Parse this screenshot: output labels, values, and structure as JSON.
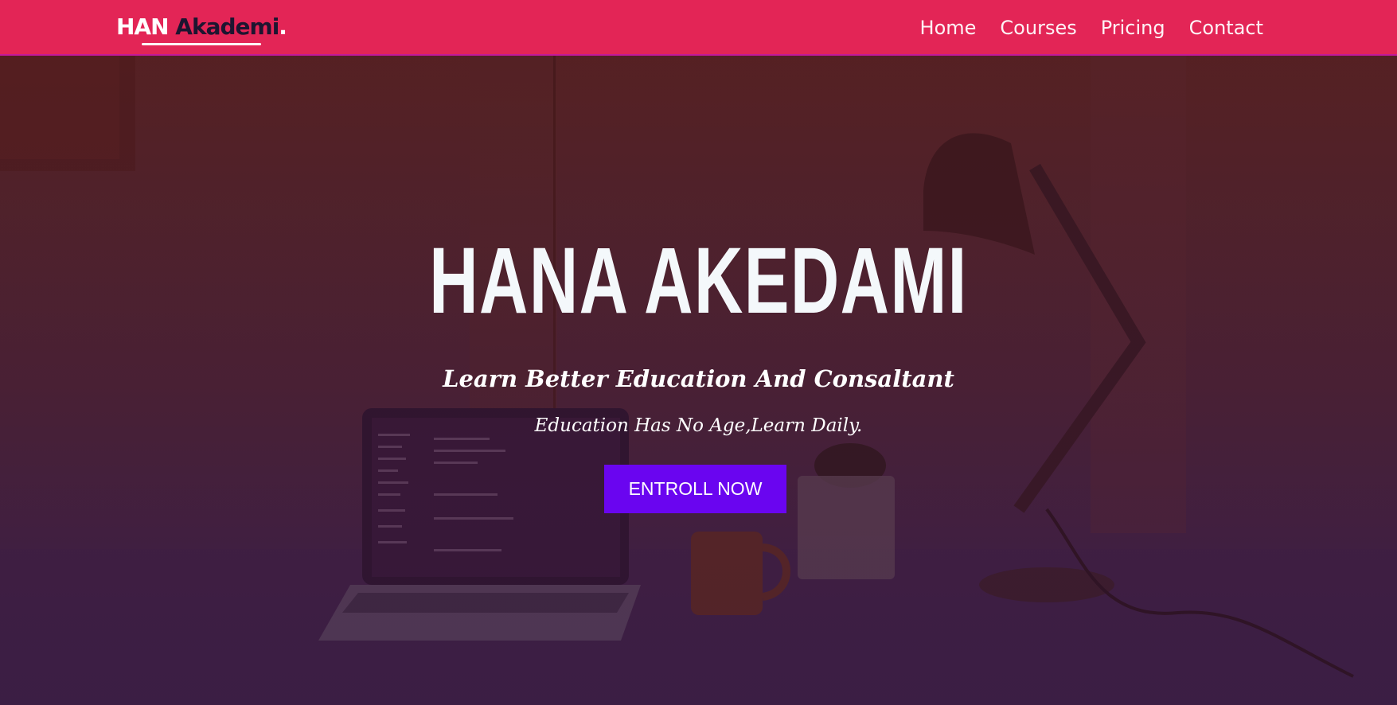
{
  "navbar": {
    "brand": {
      "first": "HAN",
      "second": "Akademi",
      "dot": "."
    },
    "links": [
      {
        "label": "Home"
      },
      {
        "label": "Courses"
      },
      {
        "label": "Pricing"
      },
      {
        "label": "Contact"
      }
    ],
    "background_color": "#e32556"
  },
  "hero": {
    "title": "HANA AKEDAMI",
    "subtitle": "Learn Better Education And Consaltant",
    "tagline": "Education Has No Age,Learn Daily.",
    "cta_label": "ENTROLL NOW",
    "cta_color": "#6a05f0",
    "background_image": "desk-workspace-with-laptop-lamp-mug-cactus"
  }
}
